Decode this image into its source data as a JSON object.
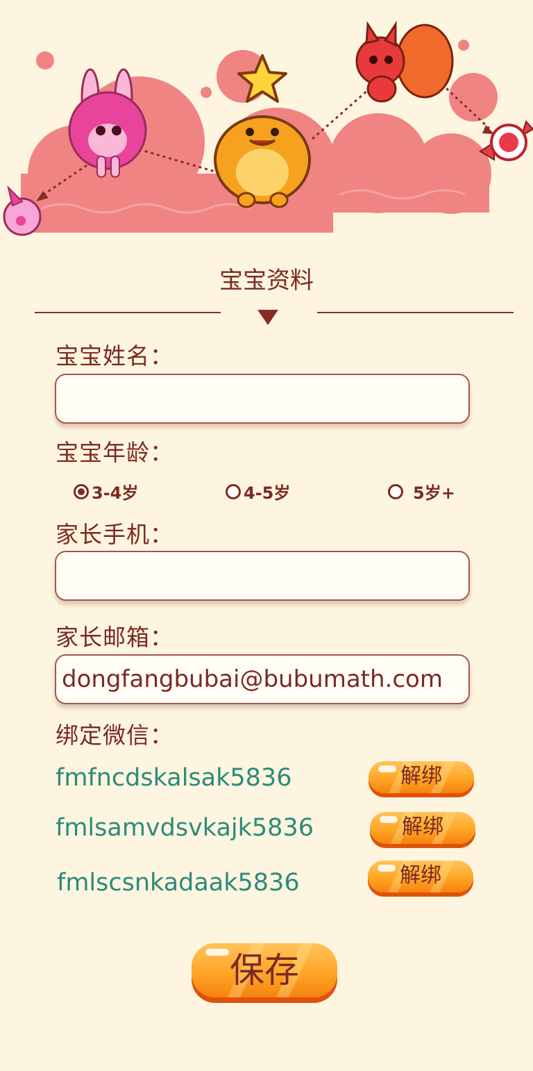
{
  "section_title": "宝宝资料",
  "fields": {
    "name_label": "宝宝姓名：",
    "name_value": "",
    "age_label": "宝宝年龄：",
    "age_options": [
      {
        "label": "3-4岁",
        "selected": true
      },
      {
        "label": "4-5岁",
        "selected": false
      },
      {
        "label": "5岁+",
        "selected": false
      }
    ],
    "phone_label": "家长手机：",
    "phone_value": "",
    "email_label": "家长邮箱：",
    "email_value": "dongfangbubai@bubumath.com",
    "wechat_label": "绑定微信："
  },
  "wechat_bindings": [
    {
      "id": "fmfncdskalsak5836",
      "unbind_label": "解绑"
    },
    {
      "id": "fmlsamvdsvkajk5836",
      "unbind_label": "解绑"
    },
    {
      "id": "fmlscsnkadaak5836",
      "unbind_label": "解绑"
    }
  ],
  "save_label": "保存",
  "colors": {
    "background": "#fdf5df",
    "primary_text": "#7a2a22",
    "wechat_text": "#2c8a7a",
    "button_orange": "#ffa626",
    "cloud_pink": "#f08482"
  },
  "illustration": {
    "characters": [
      "pink-bunny",
      "orange-monster",
      "red-squirrel"
    ],
    "items": [
      "star",
      "pink-gift",
      "candy"
    ]
  }
}
